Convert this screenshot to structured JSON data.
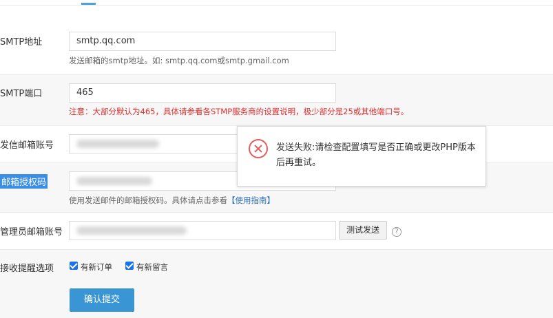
{
  "form": {
    "smtp_host": {
      "label": "SMTP地址",
      "value": "smtp.qq.com",
      "help": "发送邮箱的smtp地址。如: smtp.qq.com或smtp.gmail.com"
    },
    "smtp_port": {
      "label": "SMTP端口",
      "value": "465",
      "help": "注意：大部分默认为465，具体请参看各STMP服务商的设置说明，极少部分是25或其他端口号。"
    },
    "sender_account": {
      "label": "发信邮箱账号"
    },
    "auth_code": {
      "label": "邮箱授权码",
      "help_prefix": "使用发送邮件的邮箱授权码。具体请点击参看",
      "help_link": "【使用指南】"
    },
    "admin_account": {
      "label": "管理员邮箱账号",
      "test_button": "测试发送"
    },
    "notify": {
      "label": "接收提醒选项",
      "options": [
        {
          "label": "有新订单",
          "checked": true
        },
        {
          "label": "有新留言",
          "checked": true
        }
      ]
    },
    "submit_label": "确认提交"
  },
  "toast": {
    "message": "发送失败:请检查配置填写是否正确或更改PHP版本后再重试。"
  },
  "colors": {
    "accent": "#3a95d4",
    "warning": "#e03030",
    "error_icon": "#e25c5c"
  }
}
